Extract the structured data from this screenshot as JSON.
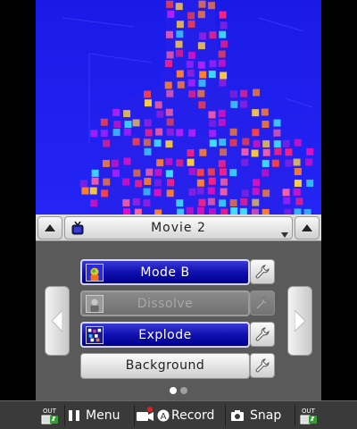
{
  "title_bar": {
    "movie_title": "Movie 2",
    "tv_icon": "tv-icon",
    "left_tab_icon": "triangle-up-icon",
    "right_tab_icon": "triangle-up-icon",
    "dropdown_icon": "triangle-down-icon"
  },
  "effects": [
    {
      "label": "Mode B",
      "state": "active",
      "thumb_icon": "mode-b-thumb-icon",
      "tool_icon": "wrench-icon"
    },
    {
      "label": "Dissolve",
      "state": "disabled",
      "thumb_icon": "dissolve-thumb-icon",
      "tool_icon": "wrench-icon"
    },
    {
      "label": "Explode",
      "state": "active",
      "thumb_icon": "explode-thumb-icon",
      "tool_icon": "wrench-icon"
    },
    {
      "label": "Background",
      "state": "plain",
      "tool_icon": "wrench-icon"
    }
  ],
  "pager": {
    "current_page": 1,
    "total_pages": 2,
    "prev_icon": "triangle-left-icon",
    "next_icon": "triangle-right-icon"
  },
  "bottom_bar": {
    "out_left_label": "OUT",
    "menu_label": "Menu",
    "record_label": "Record",
    "record_button_glyph": "A",
    "snap_label": "Snap",
    "out_right_label": "OUT"
  },
  "colors": {
    "camera_bg": "#1c1cf0",
    "active_effect": "#1010b0",
    "screen_bg": "#5a5a5a",
    "dot_active": "#ffffff",
    "dot_inactive": "#a0a0a0",
    "record_red": "#e02020"
  }
}
